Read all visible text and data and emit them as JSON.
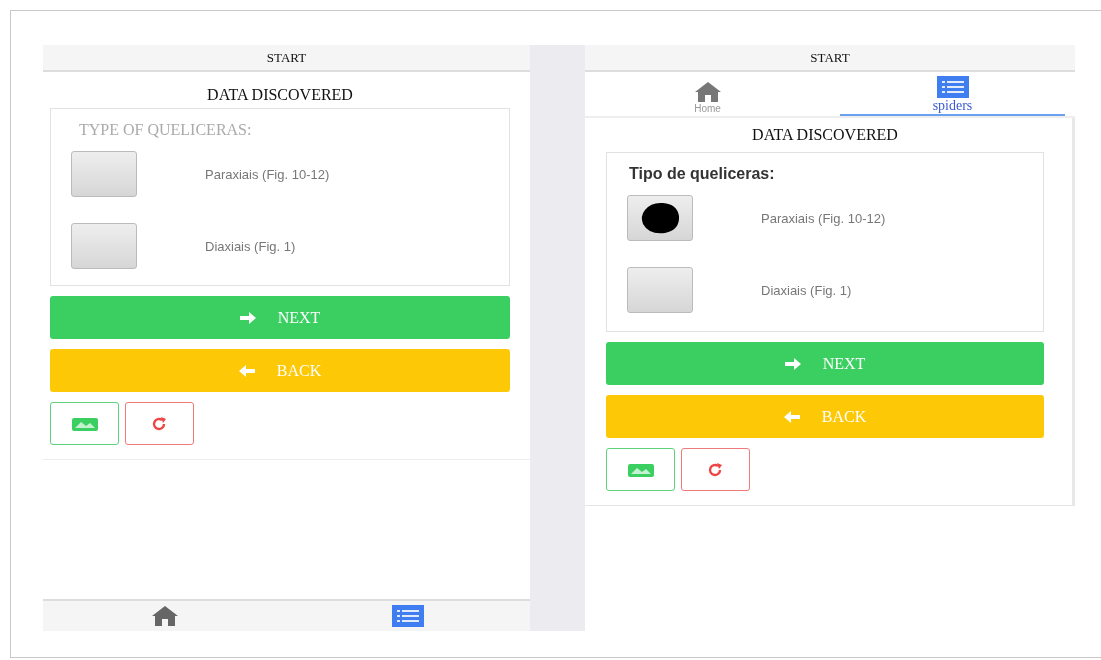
{
  "screens": [
    {
      "kind": "bottom-nav",
      "header": "START",
      "title": "DATA DISCOVERED",
      "question": "TYPE OF QUELICERAS:",
      "options": [
        {
          "label": "Paraxiais (Fig. 10-12)",
          "selected": false
        },
        {
          "label": "Diaxiais (Fig. 1)",
          "selected": false
        }
      ],
      "next": "NEXT",
      "back": "BACK",
      "nav": [
        {
          "kind": "home",
          "selected": false
        },
        {
          "kind": "list",
          "selected": true
        }
      ]
    },
    {
      "kind": "tabs",
      "header": "START",
      "title": "DATA DISCOVERED",
      "question": "Tipo de queliceras:",
      "tabs": [
        {
          "kind": "home",
          "label": "Home",
          "selected": false
        },
        {
          "kind": "list",
          "label": "spiders",
          "selected": true
        }
      ],
      "options": [
        {
          "label": "Paraxiais (Fig. 10-12)",
          "selected": true
        },
        {
          "label": "Diaxiais (Fig. 1)",
          "selected": false
        }
      ],
      "next": "NEXT",
      "back": "BACK"
    }
  ]
}
